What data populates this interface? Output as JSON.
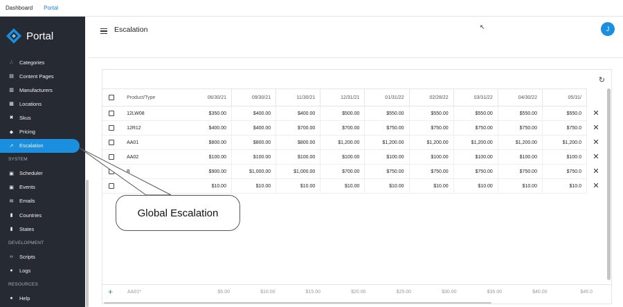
{
  "topbar": {
    "tabs": [
      "Dashboard",
      "Portal"
    ]
  },
  "sidebar": {
    "logo_text": "Portal",
    "items_top": [
      {
        "label": "Categories",
        "icon": "sitemap-icon"
      },
      {
        "label": "Content Pages",
        "icon": "document-icon"
      },
      {
        "label": "Manufacturers",
        "icon": "factory-icon"
      },
      {
        "label": "Locations",
        "icon": "map-icon"
      },
      {
        "label": "Skus",
        "icon": "cross-arrows-icon"
      },
      {
        "label": "Pricing",
        "icon": "tag-icon"
      },
      {
        "label": "Escalation",
        "icon": "trend-up-icon"
      }
    ],
    "section_system": "SYSTEM",
    "items_system": [
      {
        "label": "Scheduler",
        "icon": "calendar-icon"
      },
      {
        "label": "Events",
        "icon": "event-icon"
      },
      {
        "label": "Emails",
        "icon": "mail-icon"
      },
      {
        "label": "Countries",
        "icon": "book-icon"
      },
      {
        "label": "States",
        "icon": "book-icon"
      }
    ],
    "section_development": "DEVELOPMENT",
    "items_development": [
      {
        "label": "Scripts",
        "icon": "code-icon"
      },
      {
        "label": "Logs",
        "icon": "info-icon"
      }
    ],
    "section_resources": "RESOURCES",
    "items_resources": [
      {
        "label": "Help",
        "icon": "help-icon"
      }
    ]
  },
  "header": {
    "title": "Escalation",
    "avatar_initial": "J"
  },
  "table": {
    "product_header": "Product/Type",
    "dates": [
      "06/30/21",
      "09/30/21",
      "11/30/21",
      "12/31/21",
      "01/31/22",
      "02/28/22",
      "03/31/22",
      "04/30/22",
      "05/31/"
    ],
    "rows": [
      {
        "product": "12LW08",
        "values": [
          "$350.00",
          "$400.00",
          "$400.00",
          "$500.00",
          "$550.00",
          "$550.00",
          "$550.00",
          "$550.00",
          "$550.0"
        ]
      },
      {
        "product": "12R12",
        "values": [
          "$400.00",
          "$400.00",
          "$700.00",
          "$700.00",
          "$750.00",
          "$750.00",
          "$750.00",
          "$750.00",
          "$750.0"
        ]
      },
      {
        "product": "AA01",
        "values": [
          "$800.00",
          "$800.00",
          "$800.00",
          "$1,200.00",
          "$1,200.00",
          "$1,200.00",
          "$1,200.00",
          "$1,200.00",
          "$1,200.0"
        ]
      },
      {
        "product": "AA02",
        "values": [
          "$100.00",
          "$100.00",
          "$100.00",
          "$100.00",
          "$100.00",
          "$100.00",
          "$100.00",
          "$100.00",
          "$100.0"
        ]
      },
      {
        "product": "B",
        "values": [
          "$900.00",
          "$1,000.00",
          "$1,000.00",
          "$700.00",
          "$750.00",
          "$750.00",
          "$750.00",
          "$750.00",
          "$750.0"
        ]
      },
      {
        "product": "",
        "values": [
          "$10.00",
          "$10.00",
          "$10.00",
          "$10.00",
          "$10.00",
          "$10.00",
          "$10.00",
          "$10.00",
          "$10.0"
        ]
      }
    ],
    "new_row": {
      "placeholder": "AA01*",
      "values": [
        "$5.00",
        "$10.00",
        "$15.00",
        "$20.00",
        "$25.00",
        "$30.00",
        "$35.00",
        "$40.00",
        "$45.0"
      ]
    }
  },
  "callout": {
    "text": "Global Escalation"
  }
}
